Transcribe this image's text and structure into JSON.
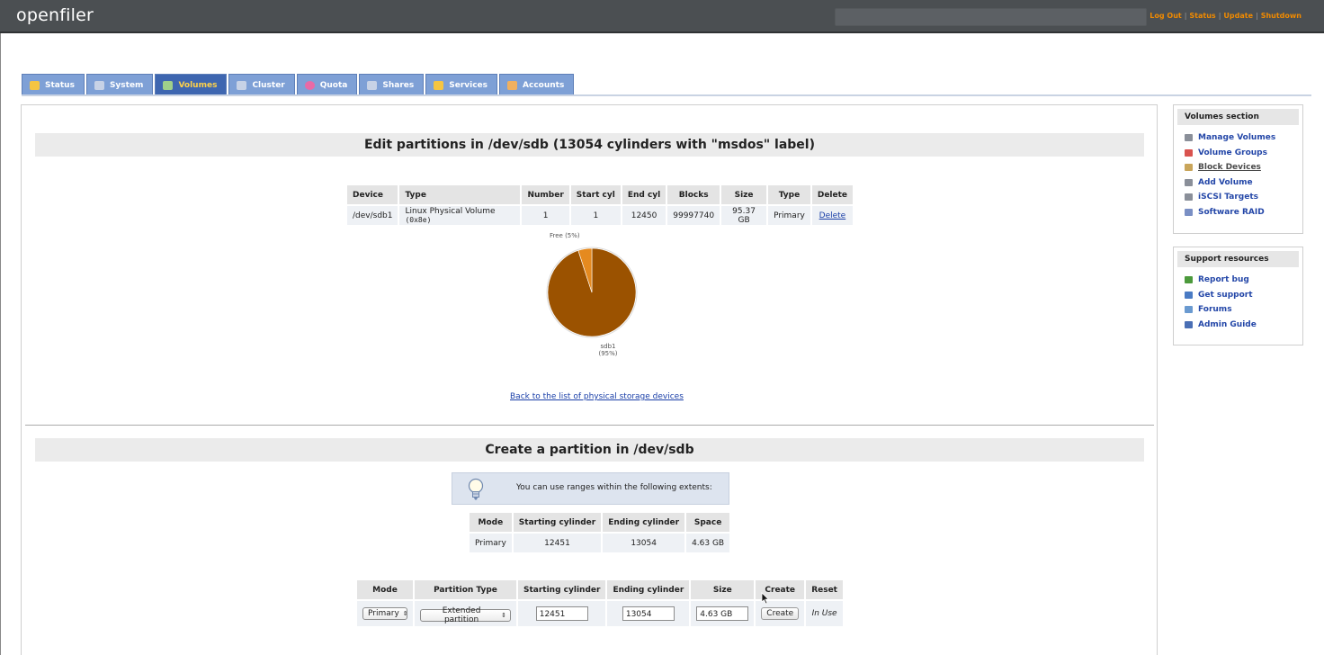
{
  "app": {
    "logo": "openfiler",
    "top_links": [
      "Log Out",
      "Status",
      "Update",
      "Shutdown"
    ]
  },
  "tabs": [
    {
      "label": "Status",
      "icon": "status-icon",
      "active": false
    },
    {
      "label": "System",
      "icon": "system-icon",
      "active": false
    },
    {
      "label": "Volumes",
      "icon": "volumes-icon",
      "active": true
    },
    {
      "label": "Cluster",
      "icon": "cluster-icon",
      "active": false
    },
    {
      "label": "Quota",
      "icon": "quota-icon",
      "active": false
    },
    {
      "label": "Shares",
      "icon": "shares-icon",
      "active": false
    },
    {
      "label": "Services",
      "icon": "services-icon",
      "active": false
    },
    {
      "label": "Accounts",
      "icon": "accounts-icon",
      "active": false
    }
  ],
  "edit": {
    "title": "Edit partitions in /dev/sdb (13054 cylinders with \"msdos\" label)",
    "headers": [
      "Device",
      "Type",
      "Number",
      "Start cyl",
      "End cyl",
      "Blocks",
      "Size",
      "Type",
      "Delete"
    ],
    "row": {
      "device": "/dev/sdb1",
      "type": "Linux Physical Volume",
      "type_code": "(0x8e)",
      "number": "1",
      "start_cyl": "1",
      "end_cyl": "12450",
      "blocks": "99997740",
      "size": "95.37 GB",
      "ptype": "Primary",
      "delete": "Delete"
    },
    "back_link": "Back to the list of physical storage devices"
  },
  "chart_data": {
    "type": "pie",
    "slices": [
      {
        "label": "sdb1",
        "percent_label": "(95%)",
        "value": 95,
        "color": "#9b5200"
      },
      {
        "label": "Free (5%)",
        "value": 5,
        "color": "#e58a1f"
      }
    ]
  },
  "create": {
    "title": "Create a partition in /dev/sdb",
    "hint": "You can use ranges within the following extents:",
    "extents_headers": [
      "Mode",
      "Starting cylinder",
      "Ending cylinder",
      "Space"
    ],
    "extents_row": {
      "mode": "Primary",
      "start": "12451",
      "end": "13054",
      "space": "4.63 GB"
    },
    "form_headers": [
      "Mode",
      "Partition Type",
      "Starting cylinder",
      "Ending cylinder",
      "Size",
      "Create",
      "Reset"
    ],
    "form": {
      "mode": "Primary",
      "partition_type": "Extended partition",
      "start": "12451",
      "end": "13054",
      "size": "4.63 GB",
      "create_button": "Create",
      "reset_text": "In Use"
    }
  },
  "sidebar": {
    "volumes_title": "Volumes section",
    "volumes_items": [
      {
        "label": "Manage Volumes",
        "icon": "manage-volumes-icon",
        "color": "#8a8f99"
      },
      {
        "label": "Volume Groups",
        "icon": "volume-groups-icon",
        "color": "#d9534f"
      },
      {
        "label": "Block Devices",
        "icon": "block-devices-icon",
        "color": "#c9a55a"
      },
      {
        "label": "Add Volume",
        "icon": "add-volume-icon",
        "color": "#8a8f99"
      },
      {
        "label": "iSCSI Targets",
        "icon": "iscsi-targets-icon",
        "color": "#8a8f99"
      },
      {
        "label": "Software RAID",
        "icon": "software-raid-icon",
        "color": "#7a8fc4"
      }
    ],
    "support_title": "Support resources",
    "support_items": [
      {
        "label": "Report bug",
        "icon": "report-bug-icon",
        "color": "#4c9a3c"
      },
      {
        "label": "Get support",
        "icon": "get-support-icon",
        "color": "#4a7bc4"
      },
      {
        "label": "Forums",
        "icon": "forums-icon",
        "color": "#6a9ad0"
      },
      {
        "label": "Admin Guide",
        "icon": "admin-guide-icon",
        "color": "#4a6fb5"
      }
    ]
  }
}
